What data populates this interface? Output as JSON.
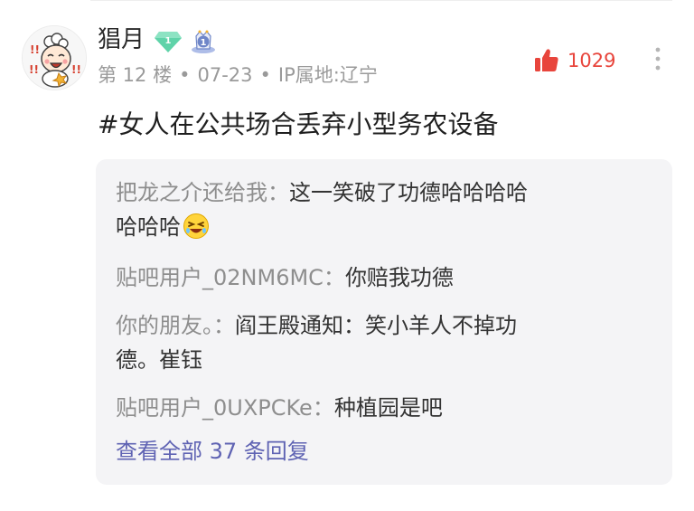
{
  "post": {
    "username": "猖月",
    "level_badge_text": "1",
    "member_badge_text": "1",
    "floor": "第 12 楼",
    "date": "07-23",
    "ip_location": "IP属地:辽宁",
    "separator": "•",
    "like_count": "1029",
    "content": "#女人在公共场合丢弃小型务农设备"
  },
  "replies": [
    {
      "author": "把龙之介还给我：",
      "text": "这一笑破了功德哈哈哈哈",
      "text_line2": "哈哈哈",
      "emoji": "laughing-emoji"
    },
    {
      "author": "贴吧用户_02NM6MC：",
      "text": "你赔我功德"
    },
    {
      "author": "你的朋友。：",
      "text": "阎王殿通知：笑小羊人不掉功",
      "text_line2": "德。崔钰"
    },
    {
      "author": "贴吧用户_0UXPCKe：",
      "text": "种植园是吧"
    }
  ],
  "view_all": "查看全部 37 条回复",
  "colors": {
    "like_red": "#e8453c",
    "link_purple": "#5f63b3",
    "reply_bg": "#f4f4f6",
    "level_badge_green": "#5fd3a9",
    "member_badge_blue": "#6f86c8"
  },
  "icons": {
    "avatar": "cartoon-sheep-avatar",
    "level": "level-diamond-icon",
    "member": "member-crown-icon",
    "like": "thumbs-up-icon",
    "more": "vertical-ellipsis-icon"
  }
}
